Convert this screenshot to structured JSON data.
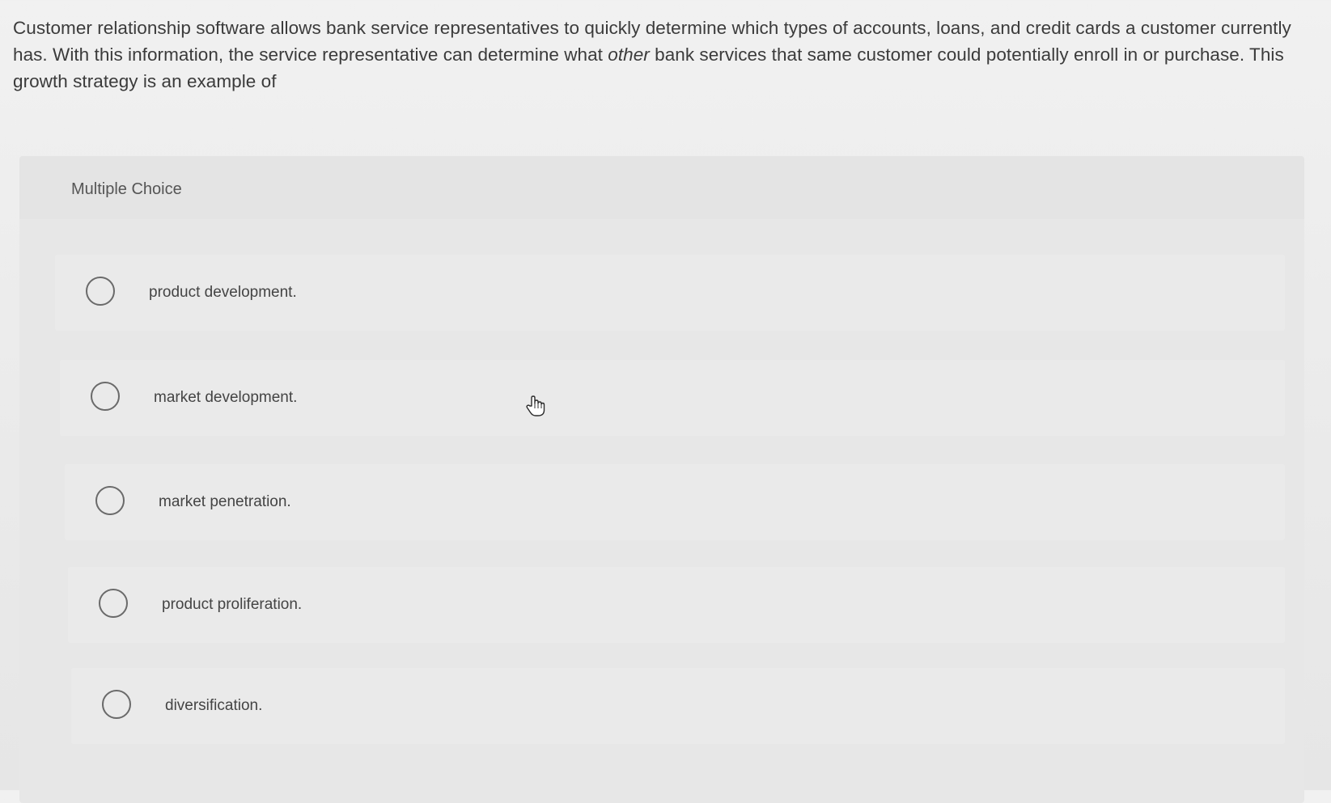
{
  "question": {
    "text_before": "Customer relationship software allows bank service representatives to quickly determine which types of accounts, loans, and credit cards a customer currently has. With this information, the service representative can determine what ",
    "emphasis": "other",
    "text_after": " bank services that same customer could potentially enroll in or purchase. This growth strategy is an example of"
  },
  "multiple_choice": {
    "label": "Multiple Choice",
    "options": [
      {
        "label": "product development."
      },
      {
        "label": "market development."
      },
      {
        "label": "market penetration."
      },
      {
        "label": "product proliferation."
      },
      {
        "label": "diversification."
      }
    ]
  },
  "icons": {
    "cursor": "hand-pointer-icon",
    "radio": "radio-button-unselected"
  }
}
